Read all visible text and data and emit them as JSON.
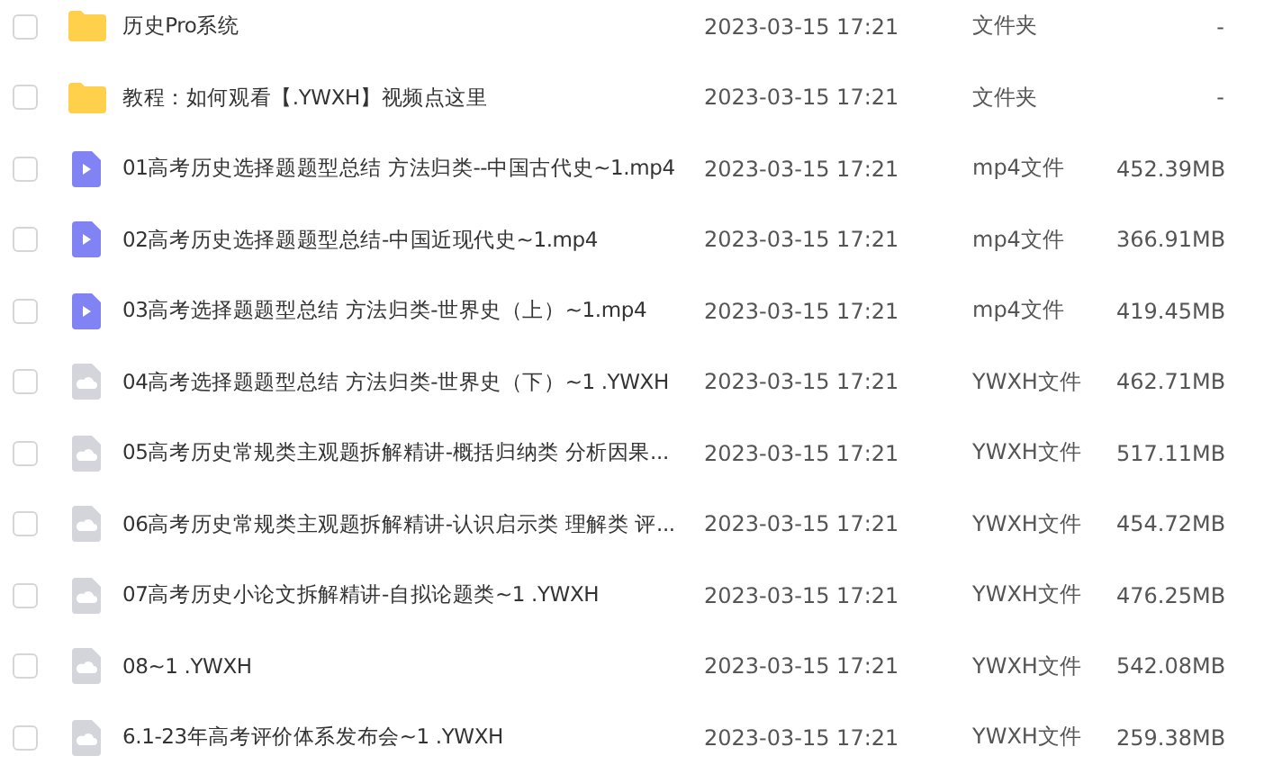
{
  "files": [
    {
      "kind": "folder",
      "checked": false,
      "name": "历史Pro系统",
      "modified": "2023-03-15 17:21",
      "type": "文件夹",
      "size": "-"
    },
    {
      "kind": "folder",
      "checked": false,
      "name": "教程：如何观看【.YWXH】视频点这里",
      "modified": "2023-03-15 17:21",
      "type": "文件夹",
      "size": "-"
    },
    {
      "kind": "video",
      "checked": false,
      "name": "01高考历史选择题题型总结 方法归类--中国古代史~1.mp4",
      "modified": "2023-03-15 17:21",
      "type": "mp4文件",
      "size": "452.39MB"
    },
    {
      "kind": "video",
      "checked": false,
      "name": "02高考历史选择题题型总结-中国近现代史~1.mp4",
      "modified": "2023-03-15 17:21",
      "type": "mp4文件",
      "size": "366.91MB"
    },
    {
      "kind": "video",
      "checked": false,
      "name": "03高考选择题题型总结 方法归类-世界史（上）~1.mp4",
      "modified": "2023-03-15 17:21",
      "type": "mp4文件",
      "size": "419.45MB"
    },
    {
      "kind": "cloud",
      "checked": false,
      "name": "04高考选择题题型总结 方法归类-世界史（下）~1 .YWXH",
      "modified": "2023-03-15 17:21",
      "type": "YWXH文件",
      "size": "462.71MB"
    },
    {
      "kind": "cloud",
      "checked": false,
      "name": "05高考历史常规类主观题拆解精讲-概括归纳类 分析因果...",
      "modified": "2023-03-15 17:21",
      "type": "YWXH文件",
      "size": "517.11MB"
    },
    {
      "kind": "cloud",
      "checked": false,
      "name": "06高考历史常规类主观题拆解精讲-认识启示类 理解类 评...",
      "modified": "2023-03-15 17:21",
      "type": "YWXH文件",
      "size": "454.72MB"
    },
    {
      "kind": "cloud",
      "checked": false,
      "name": "07高考历史小论文拆解精讲-自拟论题类~1 .YWXH",
      "modified": "2023-03-15 17:21",
      "type": "YWXH文件",
      "size": "476.25MB"
    },
    {
      "kind": "cloud",
      "checked": false,
      "name": "08~1 .YWXH",
      "modified": "2023-03-15 17:21",
      "type": "YWXH文件",
      "size": "542.08MB"
    },
    {
      "kind": "cloud",
      "checked": false,
      "name": "6.1-23年高考评价体系发布会~1 .YWXH",
      "modified": "2023-03-15 17:21",
      "type": "YWXH文件",
      "size": "259.38MB"
    }
  ]
}
